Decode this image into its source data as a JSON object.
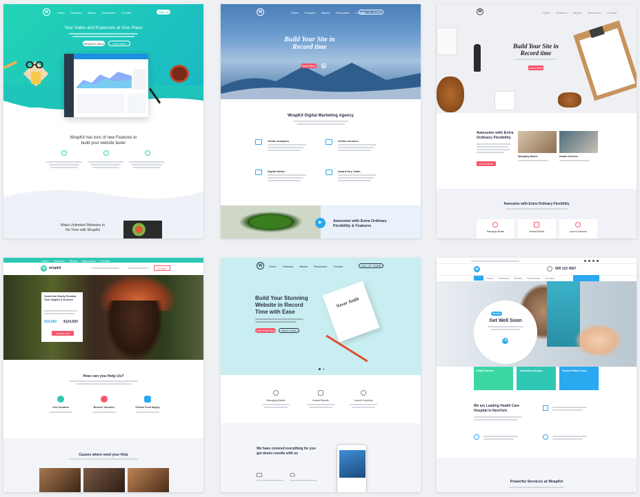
{
  "nav": {
    "items": [
      "Home",
      "Features",
      "Blocks",
      "Resources",
      "Contact"
    ],
    "signup": "Sign up",
    "call": "CALL US : 123456"
  },
  "t1": {
    "hero": "Your Sales and Expenses at One Place",
    "btn1": "Request a demo",
    "btn2": "View Video",
    "features_title_l1": "WrapKit has tons of new Features to",
    "features_title_l2": "build your website faster",
    "bottom_l1": "Make Unlimited Websites in",
    "bottom_l2": "No Time with WrapKit"
  },
  "t2": {
    "hero_l1": "Build Your Site in",
    "hero_l2": "Record time",
    "btn": "Read More",
    "agency": "WrapKit Digital Marketing Agency",
    "services": [
      "Online Analytics",
      "Online Invoices",
      "Digital Media",
      "Award Key Claim"
    ],
    "awesome_l1": "Awesome with Extra Ordinary",
    "awesome_l2": "Flexibility & Features"
  },
  "t3": {
    "hero_l1": "Build Your Site in",
    "hero_l2": "Record time",
    "btn": "Learn More",
    "awesome_l1": "Awesome with Extra",
    "awesome_l2": "Ordinary Flexibility",
    "cards": [
      "Managing Market",
      "Instant Services"
    ],
    "section": "Awesome with Extra Ordinary Flexibility",
    "boxes": [
      "Managing Market",
      "Instant Results",
      "Launch Solutions"
    ]
  },
  "t4": {
    "brand": "wrapkit",
    "donate": "Donate",
    "card_title": "Great Kids Charity Provides Their Support & Services",
    "amount1": "$19,560",
    "amount2": "$124,500",
    "card_btn": "DONATE NOW",
    "help": "How can you Help Us?",
    "items": [
      "Give Donation",
      "Become Volunteer",
      "Provide Food Supply"
    ],
    "causes": "Causes where need your Help"
  },
  "t5": {
    "hero_l1": "Build Your Stunning",
    "hero_l2": "Website in Record",
    "hero_l3": "Time with Ease",
    "btn1": "Let's Start Now",
    "btn2": "Watch Video",
    "notebook": "Never Settle",
    "features": [
      "Managing Market",
      "Instant Results",
      "Launch Solutions"
    ],
    "covered_l1": "We have covered everything for you",
    "covered_l2": "get desire results with us"
  },
  "t6": {
    "phone": "009 123 4567",
    "tag": "Medical",
    "hero": "Get Well Soon",
    "cta": "Click Here",
    "boxes": [
      "Health Doctors",
      "Transaction Surgery",
      "Trusted Patient Cares"
    ],
    "leading_l1": "We are Leading Health Care",
    "leading_l2": "Hospital in NewYork",
    "powerful": "Powerful Services at WrapKit"
  },
  "colors": {
    "teal": "#29d3b0",
    "pink": "#f4566d",
    "blue": "#2aa8f0",
    "green": "#3dd7a6",
    "charity": "#2ec8b4"
  }
}
